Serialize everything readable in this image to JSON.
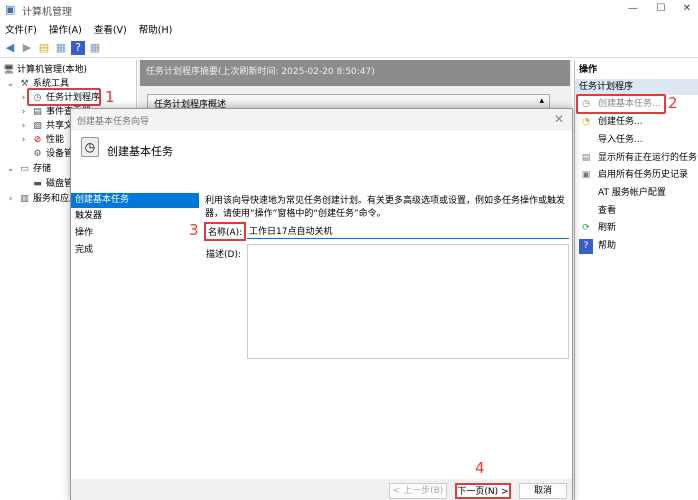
{
  "window": {
    "title": "计算机管理",
    "minimize": "—",
    "maximize": "☐",
    "close": "✕"
  },
  "menu": [
    "文件(F)",
    "操作(A)",
    "查看(V)",
    "帮助(H)"
  ],
  "tree": {
    "root": "计算机管理(本地)",
    "system_tools": "系统工具",
    "task_scheduler": "任务计划程序",
    "event_viewer": "事件查看器",
    "shared": "共享文件夹",
    "performance": "性能",
    "device_manager": "设备管理器",
    "storage": "存储",
    "disk": "磁盘管理",
    "services": "服务和应用程序"
  },
  "middle": {
    "header": "任务计划程序摘要(上次刷新时间: 2025-02-20 8:50:47)",
    "overview": "任务计划程序概述"
  },
  "actions": {
    "header": "操作",
    "section": "任务计划程序",
    "items": [
      "创建基本任务...",
      "创建任务...",
      "导入任务...",
      "显示所有正在运行的任务",
      "启用所有任务历史记录",
      "AT 服务帐户配置",
      "查看",
      "刷新",
      "帮助"
    ]
  },
  "dialog": {
    "title": "创建基本任务向导",
    "heading": "创建基本任务",
    "steps": [
      "创建基本任务",
      "触发器",
      "操作",
      "完成"
    ],
    "description": "利用该向导快速地为常见任务创建计划。有关更多高级选项或设置，例如多任务操作或触发器，请使用“操作”窗格中的“创建任务”命令。",
    "name_label": "名称(A):",
    "name_value": "工作日17点自动关机",
    "desc_label": "描述(D):",
    "back": "< 上一步(B)",
    "next": "下一页(N) >",
    "cancel": "取消"
  },
  "annotations": [
    "1",
    "2",
    "3",
    "4"
  ]
}
